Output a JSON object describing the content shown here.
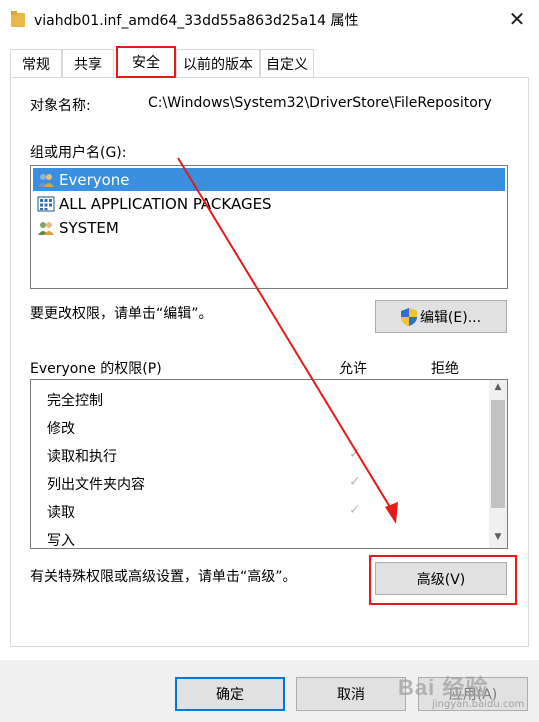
{
  "window": {
    "title": "viahdb01.inf_amd64_33dd55a863d25a14 属性",
    "close_glyph": "✕"
  },
  "tabs": [
    {
      "label": "常规"
    },
    {
      "label": "共享"
    },
    {
      "label": "安全"
    },
    {
      "label": "以前的版本"
    },
    {
      "label": "自定义"
    }
  ],
  "object": {
    "label": "对象名称:",
    "value": "C:\\Windows\\System32\\DriverStore\\FileRepository"
  },
  "groups": {
    "label": "组或用户名(G):",
    "items": [
      {
        "name": "Everyone",
        "icon": "users-icon"
      },
      {
        "name": "ALL APPLICATION PACKAGES",
        "icon": "app-packages-icon"
      },
      {
        "name": "SYSTEM",
        "icon": "users-icon"
      }
    ]
  },
  "edit": {
    "hint": "要更改权限，请单击“编辑”。",
    "button": "编辑(E)..."
  },
  "permissions": {
    "label": "Everyone 的权限(P)",
    "allow_header": "允许",
    "deny_header": "拒绝",
    "rows": [
      {
        "name": "完全控制",
        "allow": false
      },
      {
        "name": "修改",
        "allow": false
      },
      {
        "name": "读取和执行",
        "allow": true
      },
      {
        "name": "列出文件夹内容",
        "allow": true
      },
      {
        "name": "读取",
        "allow": true
      },
      {
        "name": "写入",
        "allow": false
      }
    ],
    "check_glyph": "✓"
  },
  "advanced": {
    "hint": "有关特殊权限或高级设置，请单击“高级”。",
    "button": "高级(V)"
  },
  "footer": {
    "ok": "确定",
    "cancel": "取消",
    "apply": "应用(A)"
  },
  "watermark": {
    "text": "Bai 经验",
    "sub": "jingyan.baidu.com"
  },
  "colors": {
    "highlight": "#e31b1b",
    "selection": "#3a8fde",
    "ok_border": "#0078d7"
  }
}
